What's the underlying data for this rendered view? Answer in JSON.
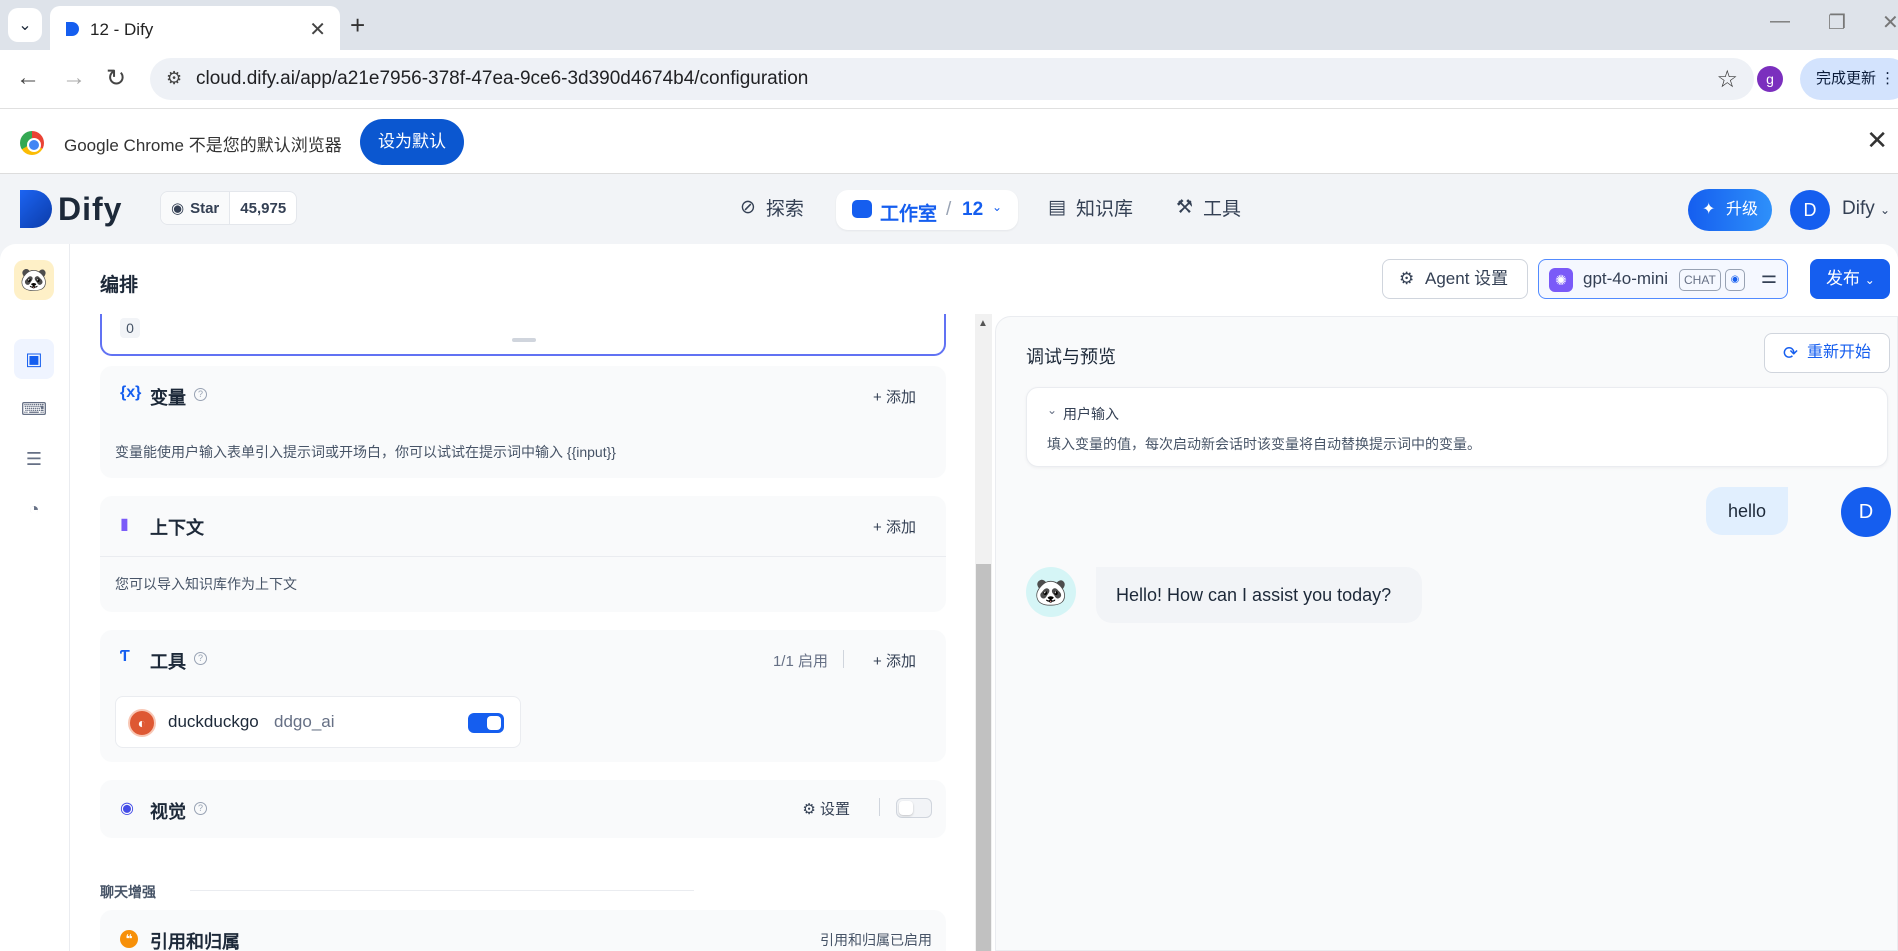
{
  "browser": {
    "tab_title": "12 - Dify",
    "url": "cloud.dify.ai/app/a21e7956-378f-47ea-9ce6-3d390d4674b4/configuration",
    "profile_initial": "g",
    "update_label": "完成更新",
    "infobar_message": "Google Chrome 不是您的默认浏览器",
    "infobar_button": "设为默认"
  },
  "header": {
    "logo_text": "Dify",
    "github_star": "Star",
    "github_count": "45,975",
    "nav": {
      "explore": "探索",
      "studio": "工作室",
      "studio_sep": "/",
      "studio_app": "12",
      "knowledge": "知识库",
      "tools": "工具"
    },
    "upgrade": "升级",
    "avatar_initial": "D",
    "account": "Dify"
  },
  "toolbar": {
    "page_title": "编排",
    "agent_settings": "Agent 设置",
    "model_name": "gpt-4o-mini",
    "model_badge": "CHAT",
    "publish": "发布"
  },
  "config": {
    "prompt_count": "0",
    "variables": {
      "title": "变量",
      "add": "添加",
      "desc": "变量能使用户输入表单引入提示词或开场白，你可以试试在提示词中输入 {{input}}"
    },
    "context": {
      "title": "上下文",
      "add": "添加",
      "desc": "您可以导入知识库作为上下文"
    },
    "tools": {
      "title": "工具",
      "enabled_count": "1/1 启用",
      "add": "添加",
      "items": [
        {
          "provider": "duckduckgo",
          "name": "ddgo_ai",
          "enabled": true
        }
      ]
    },
    "vision": {
      "title": "视觉",
      "settings": "设置",
      "enabled": false
    },
    "chat_enhance_label": "聊天增强",
    "citation": {
      "title": "引用和归属",
      "status": "引用和归属已启用"
    }
  },
  "debug": {
    "title": "调试与预览",
    "restart": "重新开始",
    "user_input_title": "用户输入",
    "user_input_desc": "填入变量的值，每次启动新会话时该变量将自动替换提示词中的变量。",
    "messages": [
      {
        "role": "user",
        "avatar": "D",
        "text": "hello"
      },
      {
        "role": "assistant",
        "text": "Hello! How can I assist you today?"
      }
    ]
  },
  "colors": {
    "accent": "#155eef",
    "prompt_border": "#6172f3",
    "chrome_button": "#0b57d0"
  }
}
